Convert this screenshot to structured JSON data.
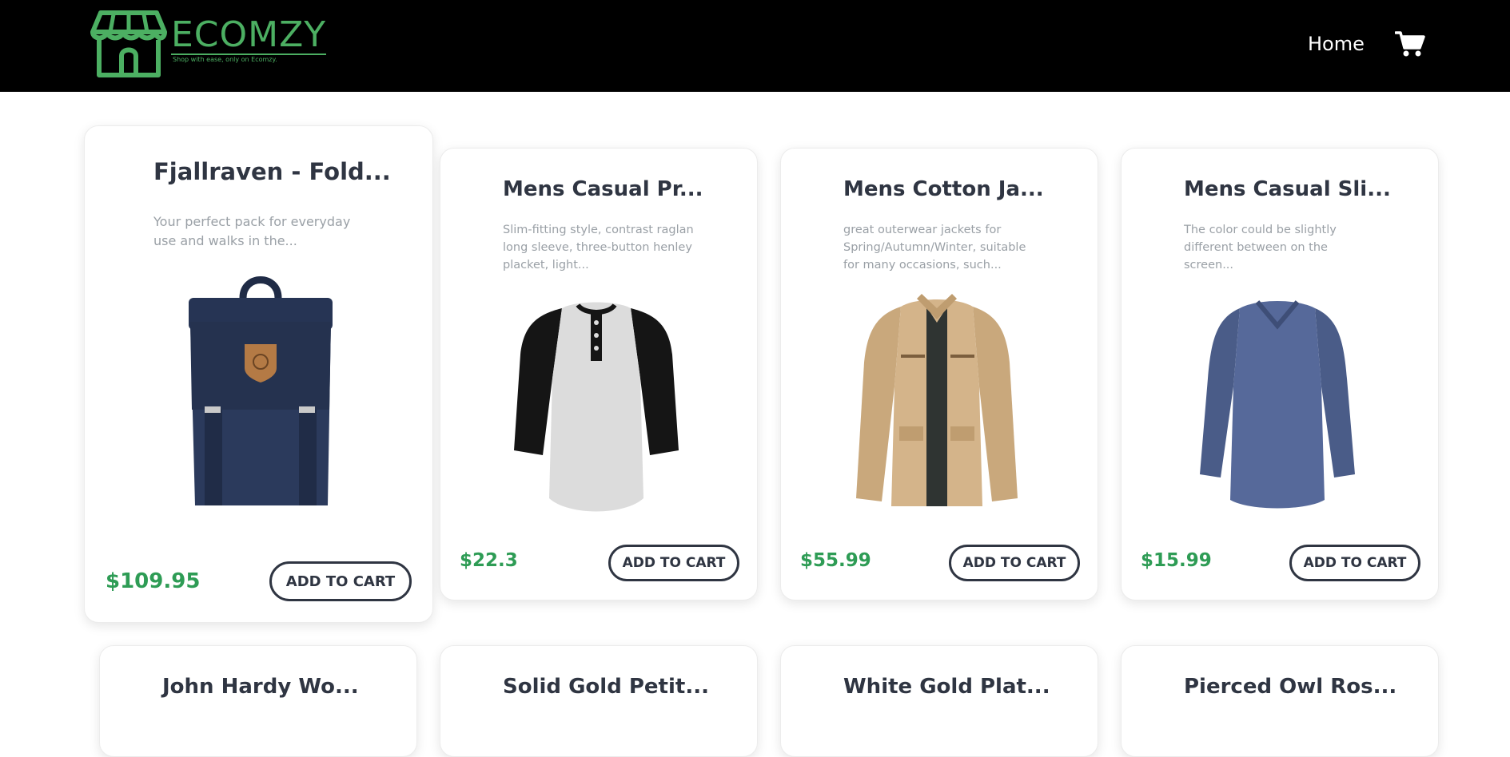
{
  "nav": {
    "brand": "ECOMZY",
    "tagline": "Shop with ease, only on Ecomzy.",
    "home_label": "Home",
    "brand_color": "#4caf62"
  },
  "products": [
    {
      "title": "Fjallraven - Fold...",
      "description": "Your perfect pack for everyday use and walks in the...",
      "price": "$109.95",
      "button": "ADD TO CART"
    },
    {
      "title": "Mens Casual Pr...",
      "description": "Slim-fitting style, contrast raglan long sleeve, three-button henley placket, light...",
      "price": "$22.3",
      "button": "ADD TO CART"
    },
    {
      "title": "Mens Cotton Ja...",
      "description": "great outerwear jackets for Spring/Autumn/Winter, suitable for many occasions, such...",
      "price": "$55.99",
      "button": "ADD TO CART"
    },
    {
      "title": "Mens Casual Sli...",
      "description": "The color could be slightly different between on the screen...",
      "price": "$15.99",
      "button": "ADD TO CART"
    },
    {
      "title": "John Hardy Wo..."
    },
    {
      "title": "Solid Gold Petit..."
    },
    {
      "title": "White Gold Plat..."
    },
    {
      "title": "Pierced Owl Ros..."
    }
  ],
  "colors": {
    "price": "#2e9c55",
    "text_dark": "#2f3542",
    "text_muted": "#9aa0a6",
    "nav_bg": "#000000"
  }
}
